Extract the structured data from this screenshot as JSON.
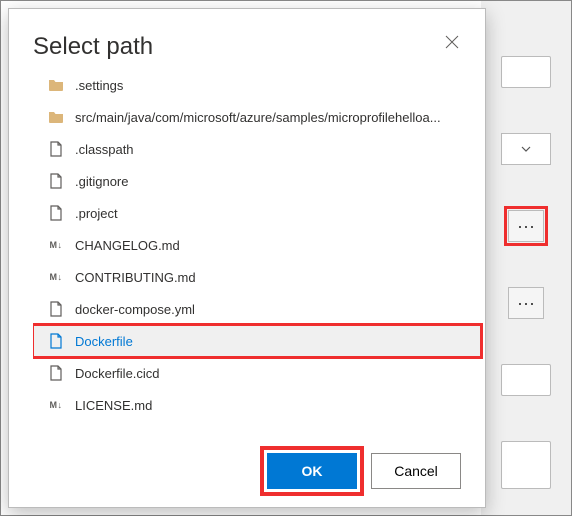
{
  "dialog": {
    "title": "Select path",
    "ok_label": "OK",
    "cancel_label": "Cancel"
  },
  "files": [
    {
      "name": ".settings",
      "type": "folder"
    },
    {
      "name": "src/main/java/com/microsoft/azure/samples/microprofilehelloa...",
      "type": "folder"
    },
    {
      "name": ".classpath",
      "type": "file"
    },
    {
      "name": ".gitignore",
      "type": "file"
    },
    {
      "name": ".project",
      "type": "file"
    },
    {
      "name": "CHANGELOG.md",
      "type": "md"
    },
    {
      "name": "CONTRIBUTING.md",
      "type": "md"
    },
    {
      "name": "docker-compose.yml",
      "type": "file"
    },
    {
      "name": "Dockerfile",
      "type": "file",
      "selected": true,
      "highlighted": true
    },
    {
      "name": "Dockerfile.cicd",
      "type": "file"
    },
    {
      "name": "LICENSE.md",
      "type": "md"
    }
  ]
}
